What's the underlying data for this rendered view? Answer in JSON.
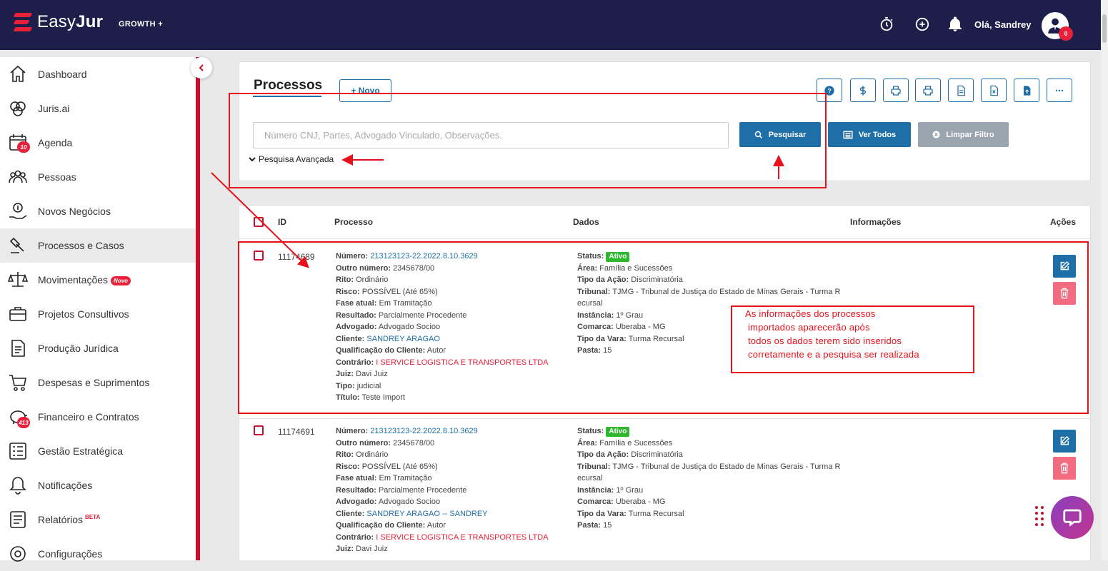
{
  "app": {
    "logo_text_light": "Easy",
    "logo_text_bold": "Jur",
    "plan": "GROWTH +",
    "greeting": "Olá, Sandrey",
    "avatar_badge": "0",
    "brand_color": "#1e1e4a",
    "accent_color": "#c8102e"
  },
  "topbar_icons": [
    "stopwatch-icon",
    "plus-circle-icon",
    "bell-icon"
  ],
  "sidebar": {
    "items": [
      {
        "label": "Dashboard",
        "icon": "home-icon"
      },
      {
        "label": "Juris.ai",
        "icon": "brain-icon"
      },
      {
        "label": "Agenda",
        "icon": "calendar-icon",
        "count": "10"
      },
      {
        "label": "Pessoas",
        "icon": "people-icon"
      },
      {
        "label": "Novos Negócios",
        "icon": "money-hand-icon"
      },
      {
        "label": "Processos e Casos",
        "icon": "gavel-icon",
        "active": true
      },
      {
        "label": "Movimentações",
        "icon": "scale-icon",
        "badge": "Novo"
      },
      {
        "label": "Projetos Consultivos",
        "icon": "briefcase-icon"
      },
      {
        "label": "Produção Jurídica",
        "icon": "document-icon"
      },
      {
        "label": "Despesas e Suprimentos",
        "icon": "cart-icon"
      },
      {
        "label": "Financeiro e Contratos",
        "icon": "piggy-bank-icon",
        "count": "413"
      },
      {
        "label": "Gestão Estratégica",
        "icon": "strategy-icon"
      },
      {
        "label": "Notificações",
        "icon": "bell-icon"
      },
      {
        "label": "Relatórios",
        "icon": "report-icon",
        "beta": "BETA"
      },
      {
        "label": "Configurações",
        "icon": "gear-icon"
      }
    ]
  },
  "header": {
    "title": "Processos",
    "new_button": "+ Novo",
    "toolbar_icons": [
      "help-icon",
      "dollar-icon",
      "print-icon",
      "print-alt-icon",
      "file-icon",
      "excel-icon",
      "upload-file-icon",
      "more-icon"
    ]
  },
  "search": {
    "placeholder": "Número CNJ, Partes, Advogado Vinculado, Observações.",
    "value": "",
    "search_button": "Pesquisar",
    "view_all_button": "Ver Todos",
    "clear_filter_button": "Limpar Filtro",
    "advanced": "Pesquisa Avançada"
  },
  "table": {
    "columns": [
      "ID",
      "Processo",
      "Dados",
      "Informações",
      "Ações"
    ],
    "rows": [
      {
        "id": "11174689",
        "processo": [
          {
            "label": "Número:",
            "value": "213123123-22.2022.8.10.3629",
            "style": "link"
          },
          {
            "label": "Outro número:",
            "value": "2345678/00"
          },
          {
            "label": "Rito:",
            "value": "Ordinário"
          },
          {
            "label": "Risco:",
            "value": "POSSÍVEL (Até 65%)"
          },
          {
            "label": "Fase atual:",
            "value": "Em Tramitação"
          },
          {
            "label": "Resultado:",
            "value": "Parcialmente Procedente"
          },
          {
            "label": "Advogado:",
            "value": "Advogado Socioo"
          },
          {
            "label": "Cliente:",
            "value": "SANDREY ARAGAO",
            "style": "link"
          },
          {
            "label": "Qualificação do Cliente:",
            "value": "Autor"
          },
          {
            "label": "Contrário:",
            "value": "I SERVICE LOGISTICA E TRANSPORTES LTDA",
            "style": "red"
          },
          {
            "label": "Juiz:",
            "value": "Davi Juiz"
          },
          {
            "label": "Tipo:",
            "value": "judicial"
          },
          {
            "label": "Título:",
            "value": "Teste Import"
          }
        ],
        "dados": {
          "status_label": "Status:",
          "status": "Ativo",
          "area_label": "Área:",
          "area": "Família e Sucessões",
          "tipo_acao_label": "Tipo da Ação:",
          "tipo_acao": "Discriminatória",
          "tribunal_label": "Tribunal:",
          "tribunal": "TJMG - Tribunal de Justiça do Estado de Minas Gerais - Turma R",
          "tribunal_cont": "ecursal",
          "instancia_label": "Instância:",
          "instancia": "1º Grau",
          "comarca_label": "Comarca:",
          "comarca": "Uberaba - MG",
          "tipo_vara_label": "Tipo da Vara:",
          "tipo_vara": "Turma Recursal",
          "pasta_label": "Pasta:",
          "pasta": "15"
        }
      },
      {
        "id": "11174691",
        "processo": [
          {
            "label": "Número:",
            "value": "213123123-22.2022.8.10.3629",
            "style": "link"
          },
          {
            "label": "Outro número:",
            "value": "2345678/00"
          },
          {
            "label": "Rito:",
            "value": "Ordinário"
          },
          {
            "label": "Risco:",
            "value": "POSSÍVEL (Até 65%)"
          },
          {
            "label": "Fase atual:",
            "value": "Em Tramitação"
          },
          {
            "label": "Resultado:",
            "value": "Parcialmente Procedente"
          },
          {
            "label": "Advogado:",
            "value": "Advogado Socioo"
          },
          {
            "label": "Cliente:",
            "value": "SANDREY ARAGAO -- SANDREY",
            "style": "link"
          },
          {
            "label": "Qualificação do Cliente:",
            "value": "Autor"
          },
          {
            "label": "Contrário:",
            "value": "I SERVICE LOGISTICA E TRANSPORTES LTDA",
            "style": "red"
          },
          {
            "label": "Juiz:",
            "value": "Davi Juiz"
          }
        ],
        "dados": {
          "status_label": "Status:",
          "status": "Ativo",
          "area_label": "Área:",
          "area": "Família e Sucessões",
          "tipo_acao_label": "Tipo da Ação:",
          "tipo_acao": "Discriminatória",
          "tribunal_label": "Tribunal:",
          "tribunal": "TJMG - Tribunal de Justiça do Estado de Minas Gerais - Turma R",
          "tribunal_cont": "ecursal",
          "instancia_label": "Instância:",
          "instancia": "1º Grau",
          "comarca_label": "Comarca:",
          "comarca": "Uberaba - MG",
          "tipo_vara_label": "Tipo da Vara:",
          "tipo_vara": "Turma Recursal",
          "pasta_label": "Pasta:",
          "pasta": "15"
        }
      }
    ]
  },
  "annotation": {
    "lines": [
      "As informações dos processos",
      "importados aparecerão após",
      "todos os dados terem sido inseridos",
      "corretamente e a pesquisa ser realizada"
    ],
    "color": "#e8101a"
  }
}
